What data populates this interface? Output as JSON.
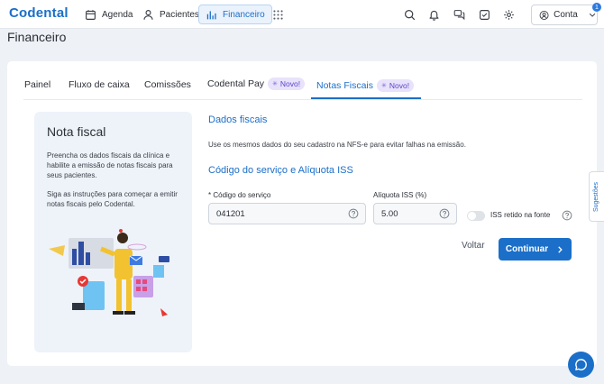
{
  "app": {
    "logo": "Codental",
    "brand_color": "#1b6fc9"
  },
  "nav": {
    "items": [
      {
        "label": "Agenda",
        "icon": "calendar-icon"
      },
      {
        "label": "Pacientes",
        "icon": "user-icon"
      },
      {
        "label": "Financeiro",
        "icon": "bar-chart-icon",
        "active": true
      }
    ],
    "apps_icon": "grid-icon"
  },
  "topbar_icons": [
    "search-icon",
    "bell-icon",
    "chat-bubbles-icon",
    "checkbox-icon",
    "gear-icon"
  ],
  "account": {
    "label": "Conta",
    "badge": "1"
  },
  "page": {
    "title": "Financeiro"
  },
  "tabs": [
    {
      "label": "Painel"
    },
    {
      "label": "Fluxo de caixa"
    },
    {
      "label": "Comissões"
    },
    {
      "label": "Codental Pay",
      "badge": "Novo!"
    },
    {
      "label": "Notas Fiscais",
      "badge": "Novo!",
      "active": true
    }
  ],
  "info_panel": {
    "title": "Nota fiscal",
    "paragraph1": "Preencha os dados fiscais da clínica e habilite a emissão de notas fiscais para seus pacientes.",
    "paragraph2": "Siga as instruções para começar a emitir notas fiscais pelo Codental."
  },
  "form": {
    "section1_title": "Dados fiscais",
    "section1_note": "Use os mesmos dados do seu cadastro na NFS-e para evitar falhas na emissão.",
    "section2_title": "Código do serviço e Alíquota ISS",
    "service_code": {
      "label": "* Código do serviço",
      "value": "041201"
    },
    "iss_rate": {
      "label": "Alíquota ISS (%)",
      "value": "5.00"
    },
    "iss_withheld": {
      "label": "ISS retido na fonte",
      "checked": false
    },
    "back_label": "Voltar",
    "continue_label": "Continuar"
  },
  "side_tab": {
    "label": "Sugestões"
  }
}
